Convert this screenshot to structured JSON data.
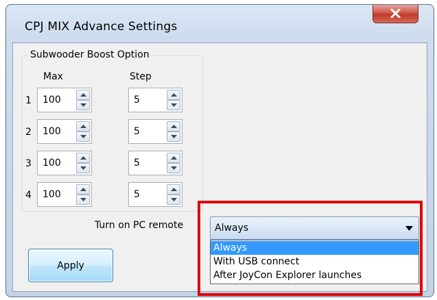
{
  "window": {
    "title": "CPJ MIX Advance Settings"
  },
  "boost_group": {
    "title": "Subwooder Boost Option",
    "col_max": "Max",
    "col_step": "Step",
    "rows": [
      {
        "index": "1",
        "max": "100",
        "step": "5"
      },
      {
        "index": "2",
        "max": "100",
        "step": "5"
      },
      {
        "index": "3",
        "max": "100",
        "step": "5"
      },
      {
        "index": "4",
        "max": "100",
        "step": "5"
      }
    ]
  },
  "remote": {
    "label": "Turn on PC remote",
    "selected": "Always",
    "options": [
      "Always",
      "With USB connect",
      "After JoyCon Explorer launches"
    ]
  },
  "apply_label": "Apply",
  "colors": {
    "highlight": "#e00000",
    "selection": "#3399ff"
  },
  "icons": {
    "close": "close-icon",
    "spin_up": "up-arrow-icon",
    "spin_down": "down-arrow-icon",
    "dropdown": "chevron-down-icon"
  }
}
